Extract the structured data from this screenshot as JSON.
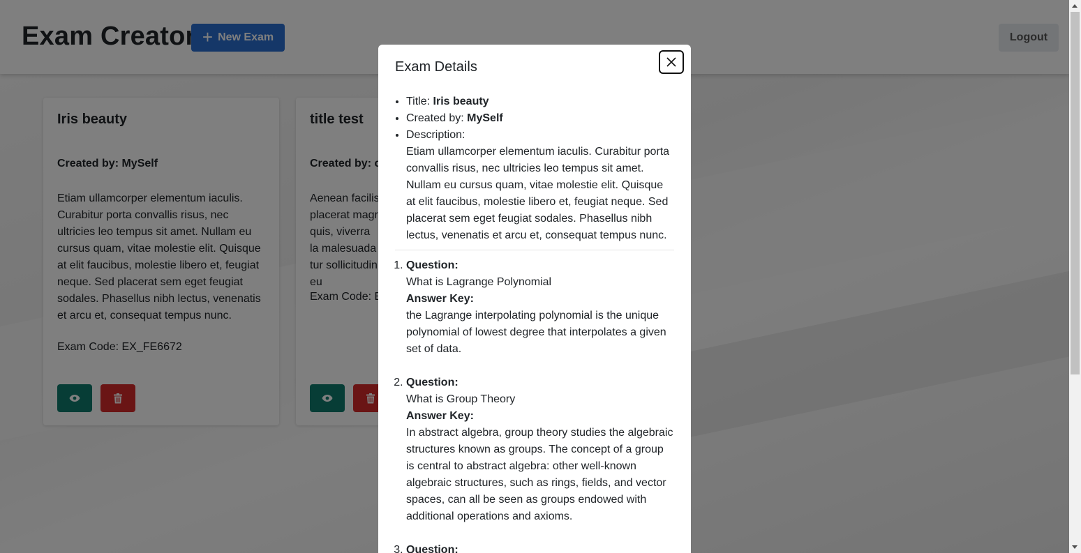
{
  "header": {
    "title": "Exam Creator",
    "new_exam_label": "New Exam",
    "logout_label": "Logout"
  },
  "cards": [
    {
      "title": "Iris beauty",
      "created_by": "Created by: MySelf",
      "description": "Etiam ullamcorper elementum iaculis. Curabitur porta convallis risus, nec ultricies leo tempus sit amet. Nullam eu cursus quam, vitae molestie elit. Quisque at elit faucibus, molestie libero et, feugiat neque. Sed placerat sem eget feugiat sodales. Phasellus nibh lectus, venenatis et arcu et, consequat tempus nunc.",
      "exam_code": "Exam Code: EX_FE6672"
    },
    {
      "title": "title test",
      "created_by": "Created by: c",
      "description": "Aenean facilis placerat magr quis, viverra la malesuada tur sollicitudin eu",
      "exam_code": "Exam Code: EX"
    }
  ],
  "modal": {
    "title": "Exam Details",
    "title_label": "Title: ",
    "title_value": "Iris beauty",
    "created_label": "Created by: ",
    "created_value": "MySelf",
    "description_label": "Description:",
    "description": "Etiam ullamcorper elementum iaculis. Curabitur porta convallis risus, nec ultricies leo tempus sit amet. Nullam eu cursus quam, vitae molestie elit. Quisque at elit faucibus, molestie libero et, feugiat neque. Sed placerat sem eget feugiat sodales. Phasellus nibh lectus, venenatis et arcu et, consequat tempus nunc.",
    "question_label": "Question:",
    "answer_label": "Answer Key:",
    "questions": [
      {
        "question": "What is Lagrange Polynomial",
        "answer": "the Lagrange interpolating polynomial is the unique polynomial of lowest degree that interpolates a given set of data."
      },
      {
        "question": "What is Group Theory",
        "answer": "In abstract algebra, group theory studies the algebraic structures known as groups. The concept of a group is central to abstract algebra: other well-known algebraic structures, such as rings, fields, and vector spaces, can all be seen as groups endowed with additional operations and axioms."
      }
    ]
  },
  "icons": {
    "plus": "plus-icon",
    "view": "eye-icon",
    "delete": "trash-icon",
    "close": "close-icon"
  },
  "colors": {
    "primary": "#2a6fd0",
    "view_button": "#0f7b6c",
    "delete_button": "#d42b2b"
  }
}
